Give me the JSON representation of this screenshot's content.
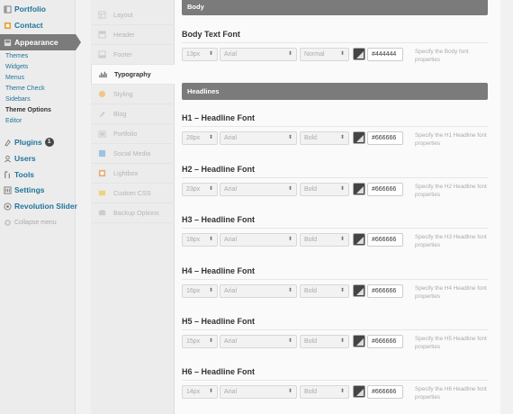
{
  "sidebar": {
    "items": [
      {
        "label": "Portfolio",
        "icon": "portfolio-icon"
      },
      {
        "label": "Contact",
        "icon": "contact-icon"
      },
      {
        "label": "Appearance",
        "icon": "appearance-icon"
      }
    ],
    "appearance_sub": [
      "Themes",
      "Widgets",
      "Menus",
      "Theme Check",
      "Sidebars",
      "Theme Options",
      "Editor"
    ],
    "lower_items": [
      {
        "label": "Plugins",
        "icon": "plugins-icon"
      },
      {
        "label": "Users",
        "icon": "users-icon"
      },
      {
        "label": "Tools",
        "icon": "tools-icon"
      },
      {
        "label": "Settings",
        "icon": "settings-icon"
      },
      {
        "label": "Revolution Slider",
        "icon": "revolution-slider-icon"
      }
    ],
    "plugins_badge": "1",
    "collapse_label": "Collapse menu"
  },
  "options_nav": {
    "tabs": [
      {
        "label": "Layout",
        "icon": "layout-icon"
      },
      {
        "label": "Header",
        "icon": "header-icon"
      },
      {
        "label": "Footer",
        "icon": "footer-icon"
      },
      {
        "label": "Typography",
        "icon": "typography-icon"
      },
      {
        "label": "Styling",
        "icon": "styling-icon"
      },
      {
        "label": "Blog",
        "icon": "blog-icon"
      },
      {
        "label": "Portfolio",
        "icon": "portfolio-icon"
      },
      {
        "label": "Social Media",
        "icon": "social-media-icon"
      },
      {
        "label": "Lightbox",
        "icon": "lightbox-icon"
      },
      {
        "label": "Custom CSS",
        "icon": "custom-css-icon"
      },
      {
        "label": "Backup Options",
        "icon": "backup-options-icon"
      }
    ],
    "active": "Typography"
  },
  "main": {
    "body_bar": "Body",
    "headlines_bar": "Headlines",
    "fonts": [
      {
        "title": "Body Text Font",
        "size": "13px",
        "family": "Arial",
        "weight": "Normal",
        "color": "#444444",
        "help": "Specify the Body font properties"
      },
      {
        "title": "H1 – Headline Font",
        "size": "28px",
        "family": "Arial",
        "weight": "Bold",
        "color": "#666666",
        "help": "Specify the H1 Headline font properties"
      },
      {
        "title": "H2 – Headline Font",
        "size": "23px",
        "family": "Arial",
        "weight": "Bold",
        "color": "#666666",
        "help": "Specify the H2 Headline font properties"
      },
      {
        "title": "H3 – Headline Font",
        "size": "18px",
        "family": "Arial",
        "weight": "Bold",
        "color": "#666666",
        "help": "Specify the H3 Headline font properties"
      },
      {
        "title": "H4 – Headline Font",
        "size": "16px",
        "family": "Arial",
        "weight": "Bold",
        "color": "#666666",
        "help": "Specify the H4 Headline font properties"
      },
      {
        "title": "H5 – Headline Font",
        "size": "15px",
        "family": "Arial",
        "weight": "Bold",
        "color": "#666666",
        "help": "Specify the H5 Headline font properties"
      },
      {
        "title": "H6 – Headline Font",
        "size": "14px",
        "family": "Arial",
        "weight": "Bold",
        "color": "#666666",
        "help": "Specify the H6 Headline font properties"
      }
    ]
  },
  "colors": {
    "link": "#21759b",
    "bar": "#7b7b7b",
    "swatch": "#444444"
  }
}
